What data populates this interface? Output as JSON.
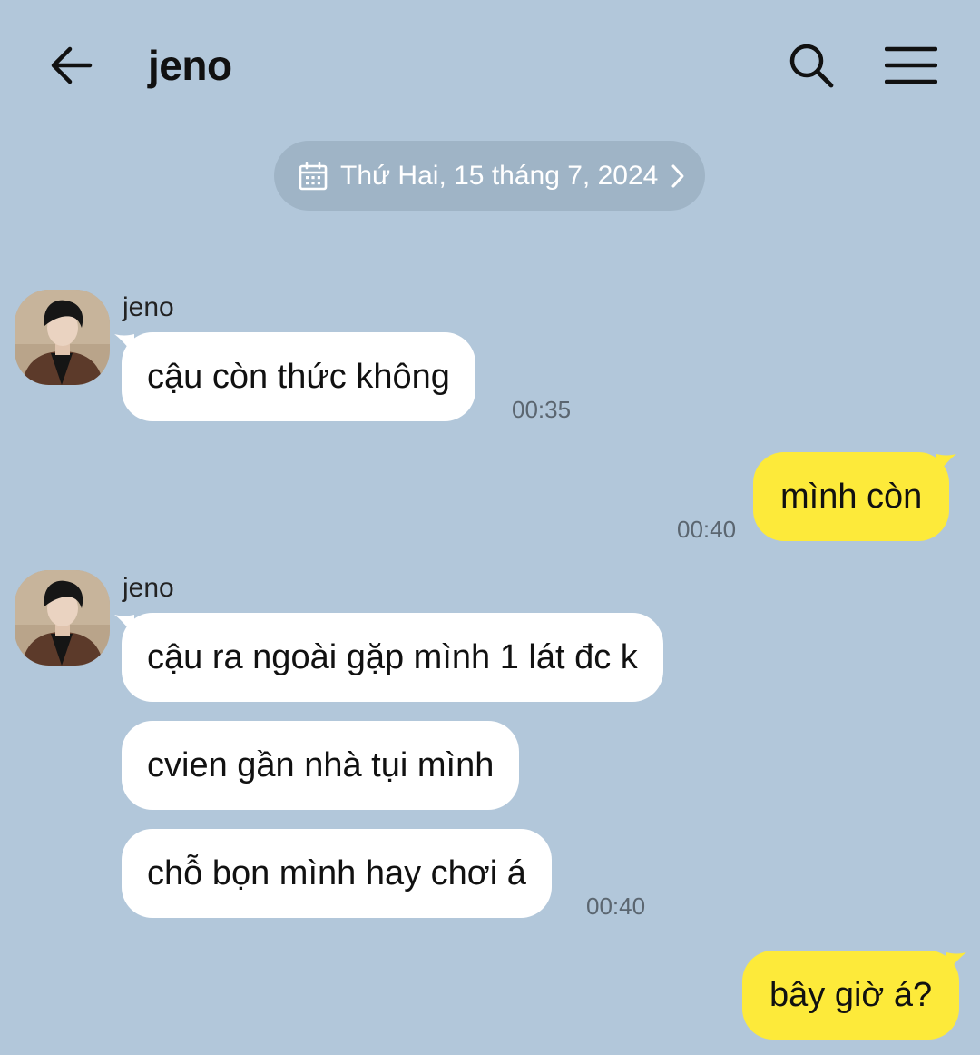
{
  "header": {
    "title": "jeno",
    "back_icon": "arrow-left-icon",
    "search_icon": "search-icon",
    "menu_icon": "hamburger-menu-icon"
  },
  "date_divider": {
    "icon": "calendar-icon",
    "text": "Thứ Hai, 15 tháng 7, 2024",
    "chevron_icon": "chevron-right-icon"
  },
  "colors": {
    "background": "#b2c7da",
    "incoming_bubble": "#ffffff",
    "outgoing_bubble": "#fdea3a",
    "date_pill": "#9fb4c6"
  },
  "messages": [
    {
      "sender": "jeno",
      "direction": "incoming",
      "text": "cậu còn thức không",
      "time": "00:35"
    },
    {
      "direction": "outgoing",
      "text": "mình còn",
      "time": "00:40"
    },
    {
      "sender": "jeno",
      "direction": "incoming",
      "text": "cậu ra ngoài gặp mình 1 lát đc k"
    },
    {
      "direction": "incoming",
      "text": "cvien gần nhà tụi mình"
    },
    {
      "direction": "incoming",
      "text": "chỗ bọn mình hay chơi á",
      "time": "00:40"
    },
    {
      "direction": "outgoing",
      "text": "bây giờ á?"
    }
  ]
}
